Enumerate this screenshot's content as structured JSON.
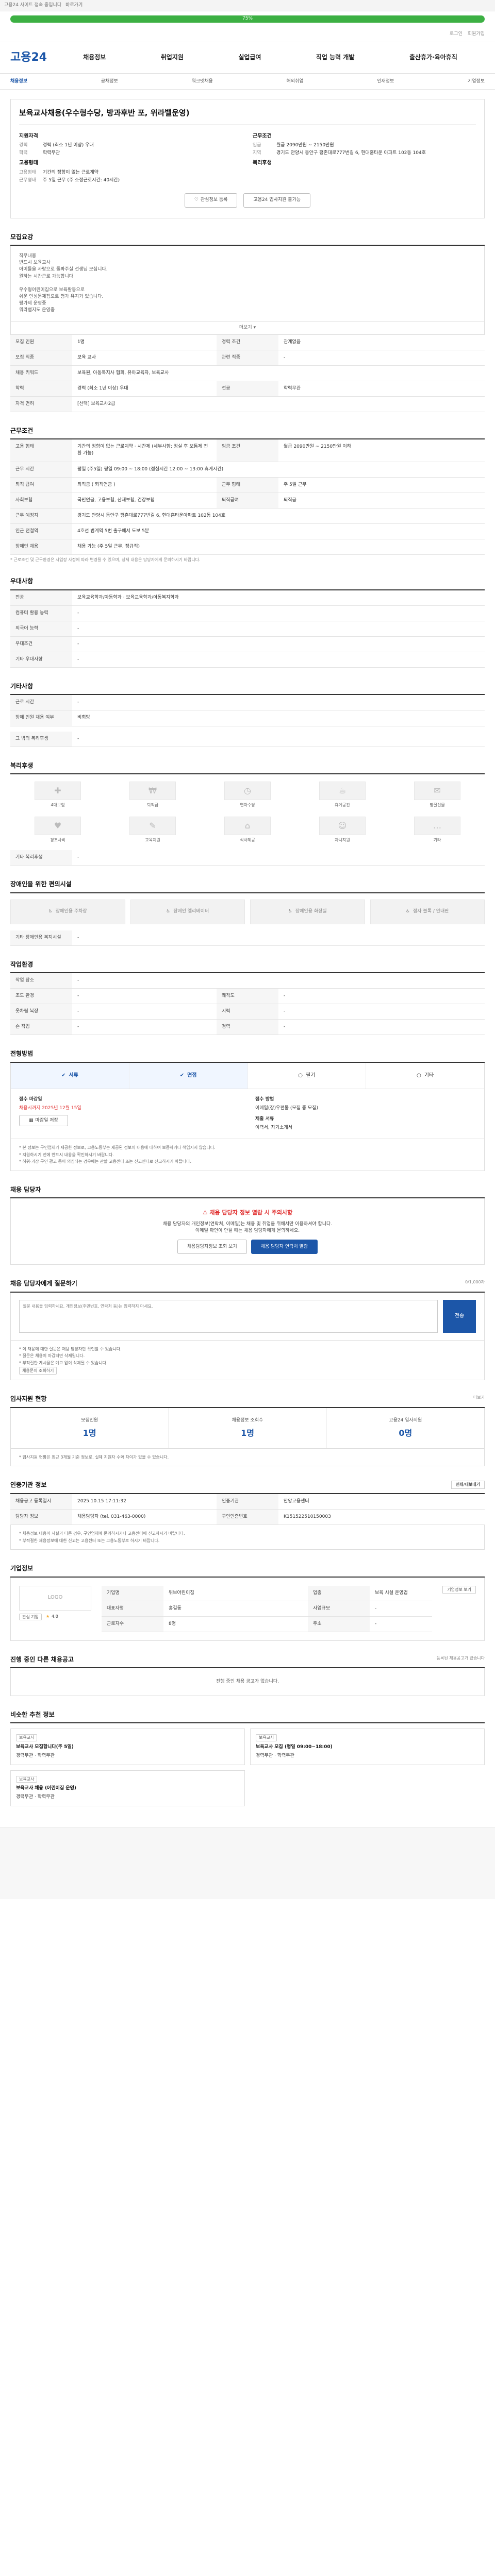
{
  "topbar": {
    "notice": "고용24 사이트 접속 중입니다",
    "link": "바로가기"
  },
  "progress": {
    "value": 1.0,
    "label": "75%"
  },
  "miniNav": [
    "로그인",
    "회원가입"
  ],
  "brand": {
    "name": "고용24"
  },
  "gnb": [
    "채용정보",
    "취업지원",
    "실업급여",
    "직업 능력 개발",
    "출산휴가·육아휴직"
  ],
  "subnav": [
    "채용정보",
    "공채정보",
    "워크넷채용",
    "해외취업",
    "인재정보",
    "기업정보"
  ],
  "job": {
    "title": "보육교사채용(우수형수당, 방과후반 포, 위라밸운영)",
    "left_heading": "지원자격",
    "left_rows": [
      {
        "k": "경력",
        "v": "경력 (최소 1년 이상) 우대"
      },
      {
        "k": "학력",
        "v": "학력무관"
      }
    ],
    "left_heading2": "고용형태",
    "left_rows2": [
      {
        "k": "고용형태",
        "v": "기간의 정함이 없는 근로계약"
      },
      {
        "k": "근무형태",
        "v": "주 5일 근무 (주 소정근로시간: 40시간)"
      }
    ],
    "right_heading": "근무조건",
    "right_rows": [
      {
        "k": "임금",
        "v": "월급 2090만원 ~ 2150만원"
      },
      {
        "k": "지역",
        "v": "경기도 안양시 동안구 평촌대로777번길 6, 현대홈타운 아파트 102동 104호"
      }
    ],
    "right_heading2": "복리후생",
    "btn_scrap": "관심정보 등록",
    "btn_apply": "고용24 입사지원 불가능"
  },
  "recruit": {
    "title": "모집요강",
    "body": [
      "직무내용",
      "반드시 보육교사",
      "아이들을 사랑으로 돌봐주실 선생님 모십니다.",
      "원하는 시간근로 가능합니다",
      "",
      "우수형어린이집으로 보육활동으로",
      "쉬운 인성문제집으로 평가 유지가 있습니다.",
      "평가제 운영중",
      "워라밸지도 운영중"
    ],
    "more": "더보기"
  },
  "recruit_table": [
    {
      "k": "모집 인원",
      "v": "1명",
      "k2": "경력 조건",
      "v2": "관계없음"
    },
    {
      "k": "모집 직종",
      "v": "보육 교사",
      "k2": "관련 직종",
      "v2": "-"
    },
    {
      "k": "채용 키워드",
      "v": "보육원, 아동복지사 협회, 유아교육자, 보육교사",
      "k2": "",
      "v2": ""
    },
    {
      "k": "학력",
      "v": "경력 (최소 1년 이상) 우대",
      "k2": "전공",
      "v2": "학력무관"
    },
    {
      "k": "자격 면허",
      "v": "[선택] 보육교사2급",
      "k2": "",
      "v2": ""
    }
  ],
  "work": {
    "title": "근무조건",
    "rows": [
      {
        "k": "고용 형태",
        "v": "기간의 정함이 없는 근로계약 · 시간제 (세부사항: 정실 후 보통제 전환 가능)",
        "k2": "임금 조건",
        "v2": "월급 2090만원 ~ 2150만원 이하"
      },
      {
        "k": "근무 시간",
        "v": "평일 (주5일) 평일 09:00 ~ 18:00 (점심시간 12:00 ~ 13:00 휴게시간)",
        "k2": "",
        "v2": ""
      },
      {
        "k": "퇴직 급여",
        "v": "퇴직금 ( 퇴직연금 )",
        "k2": "근무 형태",
        "v2": "주 5일 근무"
      },
      {
        "k": "사회보험",
        "v": "국민연금, 고용보험, 산재보험, 건강보험",
        "k2": "퇴직급여",
        "v2": "퇴직금"
      },
      {
        "k": "근무 예정지",
        "v": "경기도 안양시 동안구 평촌대로777번길 6, 현대홈타운아파트 102동 104호",
        "k2": "",
        "v2": ""
      },
      {
        "k": "인근 전철역",
        "v": "4호선 범계역 5번 출구에서 도보 5분",
        "k2": "",
        "v2": ""
      },
      {
        "k": "장애인 채용",
        "v": "채용 가능 (주 5일 근무, 정규직)",
        "k2": "",
        "v2": ""
      }
    ],
    "map_btn": "지도 보기",
    "note": "* 근로조건 및 근무환경은 사업장 사정에 따라 변경될 수 있으며, 상세 내용은 담당자에게 문의하시기 바랍니다."
  },
  "prefer": {
    "title": "우대사항",
    "rows": [
      {
        "k": "전공",
        "v": "보육교육학과/아동학과 · 보육교육학과/아동복지학과"
      },
      {
        "k": "컴퓨터 활용 능력",
        "v": "-"
      },
      {
        "k": "외국어 능력",
        "v": "-"
      },
      {
        "k": "우대조건",
        "v": "-"
      },
      {
        "k": "기타 우대사항",
        "v": "-"
      }
    ]
  },
  "etc": {
    "title": "기타사항",
    "rows": [
      {
        "k": "근로 시간",
        "v": "-"
      },
      {
        "k": "장애 인원 채용 여부",
        "v": "비희망"
      }
    ],
    "extra_k": "그 밖의 복리후생",
    "extra_v": "-"
  },
  "welfare": {
    "title": "복리후생",
    "icons": [
      {
        "name": "4대보험",
        "glyph": "✚"
      },
      {
        "name": "퇴직금",
        "glyph": "₩"
      },
      {
        "name": "연차수당",
        "glyph": "◷"
      },
      {
        "name": "휴게공간",
        "glyph": "☕"
      },
      {
        "name": "명절선물",
        "glyph": "✉"
      },
      {
        "name": "경조사비",
        "glyph": "♥"
      },
      {
        "name": "교육지원",
        "glyph": "✎"
      },
      {
        "name": "식사제공",
        "glyph": "⌂"
      },
      {
        "name": "자녀지원",
        "glyph": "☺"
      },
      {
        "name": "기타",
        "glyph": "…"
      }
    ],
    "other_k": "기타 복리후생",
    "other_v": "-"
  },
  "disabled": {
    "title": "장애인을 위한 편의시설",
    "cards": [
      "장애인용 주차장",
      "장애인 엘리베이터",
      "장애인용 화장실",
      "점자 블록 / 안내판"
    ],
    "other_k": "기타 장애인용 복지시설",
    "other_v": "-"
  },
  "env": {
    "title": "작업환경",
    "rows": [
      {
        "k": "작업 장소",
        "v": "-",
        "k2": "",
        "v2": ""
      },
      {
        "k": "조도 환경",
        "v": "-",
        "k2": "쾌적도",
        "v2": "-"
      },
      {
        "k": "옷차림 복장",
        "v": "-",
        "k2": "시력",
        "v2": "-"
      },
      {
        "k": "손 작업",
        "v": "-",
        "k2": "청력",
        "v2": "-"
      }
    ]
  },
  "method": {
    "title": "전형방법",
    "steps": [
      "서류",
      "면접",
      "필기",
      "기타"
    ],
    "recv_h": "접수 마감일",
    "recv_v": "채용시까지 2025년 12월 15일",
    "btn_save": "마감일 저장",
    "way_h": "접수 방법",
    "way_v": "이메일(장)우편물 (모집 중 모집)",
    "doc_h": "제출 서류",
    "doc_v": "이력서, 자기소개서",
    "notes": [
      "* 본 정보는 구인업체가 제공한 정보로, 고용노동부는 제공된 정보의 내용에 대하여 보증하거나 책임지지 않습니다.",
      "* 지원하시기 전에 반드시 내용을 확인하시기 바랍니다.",
      "* 허위·과장 구인 광고 등이 의심되는 경우에는 관할 고용센터 또는 신고센터로 신고하시기 바랍니다."
    ]
  },
  "contact": {
    "title": "채용 담당자",
    "alert": "채용 담당자 정보 열람 시 주의사항",
    "desc1": "채용 담당자의 개인정보(연락처, 이메일)는 채용 및 취업을 위해서만 이용하셔야 합니다.",
    "desc2": "이메일 확인이 안될 때는 채용 담당자에게 문의하세요.",
    "btn_a": "채용담당자정보 조회 보기",
    "btn_b": "채용 담당자 연락처 열람"
  },
  "qa": {
    "title": "채용 담당자에게 질문하기",
    "sub": "0/1,000자",
    "placeholder": "질문 내용을 입력하세요. 개인정보(주민번호, 연락처 등)는 입력하지 마세요.",
    "send": "전송",
    "notes": [
      "* 이 채용에 대한 질문은 채용 담당자만 확인할 수 있습니다.",
      "* 질문은 채용이 마감되면 삭제됩니다.",
      "* 부적절한 게시물은 예고 없이 삭제될 수 있습니다."
    ],
    "note_btn": "채용문의 조회하기"
  },
  "applicants": {
    "title": "입사지원 현황",
    "more": "더보기",
    "stats": [
      {
        "label": "모집인원",
        "value": "1명"
      },
      {
        "label": "채용정보 조회수",
        "value": "1명"
      },
      {
        "label": "고용24 입사지원",
        "value": "0명"
      }
    ],
    "note": "* 입사지원 현황은 최근 3개월 기준 정보로, 실제 지원자 수와 차이가 있을 수 있습니다."
  },
  "manager": {
    "title": "인증기관 정보",
    "btn": "인쇄/내보내기",
    "rows": [
      {
        "k": "채용공고 등록일시",
        "v": "2025.10.15 17:11:32",
        "k2": "인증기관",
        "v2": "안양고용센터"
      },
      {
        "k": "담당자 정보",
        "v": "채용담당자 (tel. 031-463-0000)",
        "k2": "구인인증번호",
        "v2": "K151522510150003"
      }
    ],
    "notes": [
      "* 채용정보 내용이 사실과 다른 경우, 구인업체에 문의하시거나 고용센터에 신고하시기 바랍니다.",
      "* 부적절한 채용정보에 대한 신고는 고용센터 또는 고용노동부로 하시기 바랍니다."
    ]
  },
  "company": {
    "title": "기업정보",
    "logo": "LOGO",
    "btn_info": "기업정보 보기",
    "btn_more": "관심 기업",
    "rows": [
      {
        "k": "기업명",
        "v": "위브어린이집",
        "k2": "업종",
        "v2": "보육 시설 운영업"
      },
      {
        "k": "대표자명",
        "v": "홍길동",
        "k2": "사업규모",
        "v2": "-"
      },
      {
        "k": "근로자수",
        "v": "8명",
        "k2": "주소",
        "v2": "-"
      }
    ],
    "rating": "4.0"
  },
  "similar": {
    "title": "진행 중인 다른 채용공고",
    "sub": "등록된 채용공고가 없습니다",
    "empty": "진행 중인 채용 공고가 없습니다."
  },
  "recos": {
    "title": "비슷한 추천 정보",
    "items": [
      {
        "tag": "보육교사",
        "title": "보육교사 모집합니다(주 5일)",
        "meta": "경력무관 · 학력무관"
      },
      {
        "tag": "보육교사",
        "title": "보육교사 모집 (평일 09:00~18:00)",
        "meta": "경력무관 · 학력무관"
      },
      {
        "tag": "보육교사",
        "title": "보육교사 채용 (어린이집 운영)",
        "meta": "경력무관 · 학력무관"
      }
    ]
  }
}
